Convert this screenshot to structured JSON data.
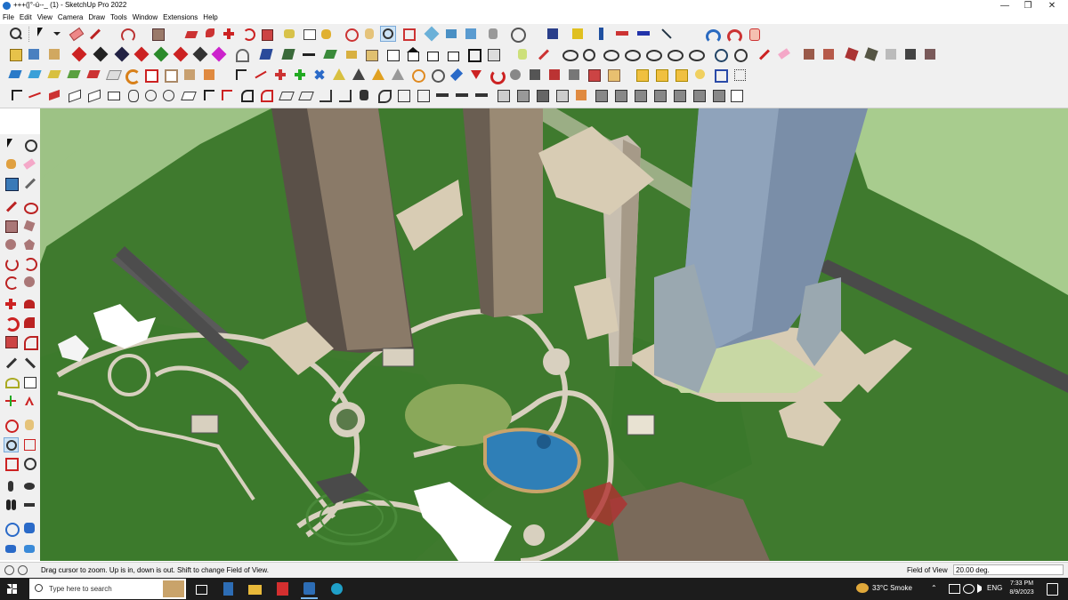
{
  "window": {
    "title": "+++(|°-ú--_ (1) - SketchUp Pro 2022",
    "minimize": "—",
    "maximize": "❐",
    "close": "✕"
  },
  "menu": [
    "File",
    "Edit",
    "View",
    "Camera",
    "Draw",
    "Tools",
    "Window",
    "Extensions",
    "Help"
  ],
  "status": {
    "hint": "Drag cursor to zoom.  Up is in, down is out. Shift to change Field of View.",
    "vcb_label": "Field of View",
    "vcb_value": "20.00 deg."
  },
  "taskbar": {
    "search_placeholder": "Type here to search",
    "weather": "33°C  Smoke",
    "language": "ENG",
    "time": "7:33 PM",
    "date": "8/9/2023"
  },
  "colors": {
    "ground_green": "#3f7a2e",
    "sky_green": "#9dc285",
    "paths": "#d8d0bf",
    "pool": "#2f7fb7",
    "tower_blue": "#7a8ea8"
  }
}
